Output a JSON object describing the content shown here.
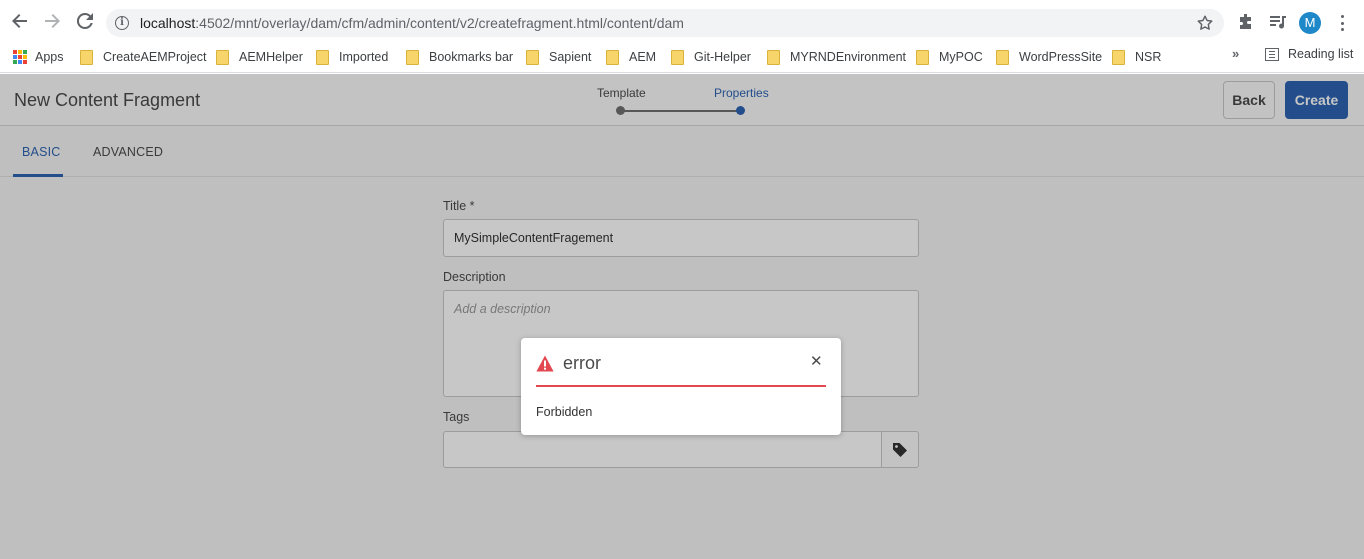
{
  "browser": {
    "url_host": "localhost",
    "url_path": ":4502/mnt/overlay/dam/cfm/admin/content/v2/createfragment.html/content/dam",
    "avatar_letter": "M",
    "bookmarks": [
      {
        "label": "Apps",
        "icon": "apps-grid-icon"
      },
      {
        "label": "CreateAEMProject",
        "icon": "folder-icon"
      },
      {
        "label": "AEMHelper",
        "icon": "folder-icon"
      },
      {
        "label": "Imported",
        "icon": "folder-icon"
      },
      {
        "label": "Bookmarks bar",
        "icon": "folder-icon"
      },
      {
        "label": "Sapient",
        "icon": "folder-icon"
      },
      {
        "label": "AEM",
        "icon": "folder-icon"
      },
      {
        "label": "Git-Helper",
        "icon": "folder-icon"
      },
      {
        "label": "MYRNDEnvironment",
        "icon": "folder-icon"
      },
      {
        "label": "MyPOC",
        "icon": "folder-icon"
      },
      {
        "label": "WordPressSite",
        "icon": "folder-icon"
      },
      {
        "label": "NSR",
        "icon": "folder-icon"
      }
    ],
    "more_label": "»",
    "reading_list": "Reading list"
  },
  "header": {
    "title": "New Content Fragment",
    "steps": [
      {
        "label": "Template",
        "active": false
      },
      {
        "label": "Properties",
        "active": true
      }
    ],
    "back_label": "Back",
    "create_label": "Create"
  },
  "tabs": [
    {
      "label": "BASIC",
      "active": true
    },
    {
      "label": "ADVANCED",
      "active": false
    }
  ],
  "form": {
    "title_label": "Title *",
    "title_value": "MySimpleContentFragement",
    "description_label": "Description",
    "description_placeholder": "Add a description",
    "tags_label": "Tags"
  },
  "dialog": {
    "title": "error",
    "message": "Forbidden",
    "close_glyph": "✕"
  },
  "colors": {
    "accent": "#2d64b3",
    "error": "#e34850",
    "avatar": "#1e88c8"
  }
}
